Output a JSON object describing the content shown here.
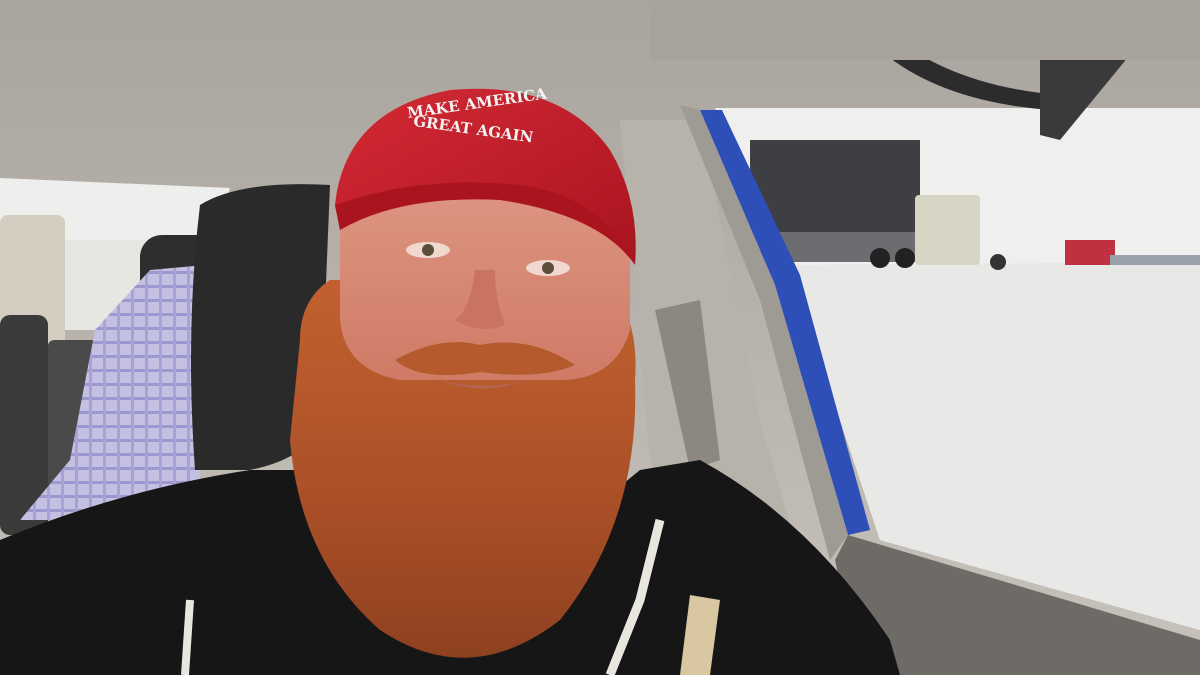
{
  "photo": {
    "hat_text_line1": "MAKE AMERICA",
    "hat_text_line2": "GREAT AGAIN"
  },
  "colors": {
    "cabin_ceiling": "#b9b4ad",
    "window_light": "#f2f2f0",
    "snow_ground": "#e9e9e7",
    "hat_red": "#c41f2c",
    "beard": "#b4532a",
    "skin": "#d98a75",
    "hoodie": "#161616",
    "headrest": "#2a2a2a",
    "door_trim_blue": "#2f4fb8",
    "shirt_plaid": "#b8b4dc"
  }
}
